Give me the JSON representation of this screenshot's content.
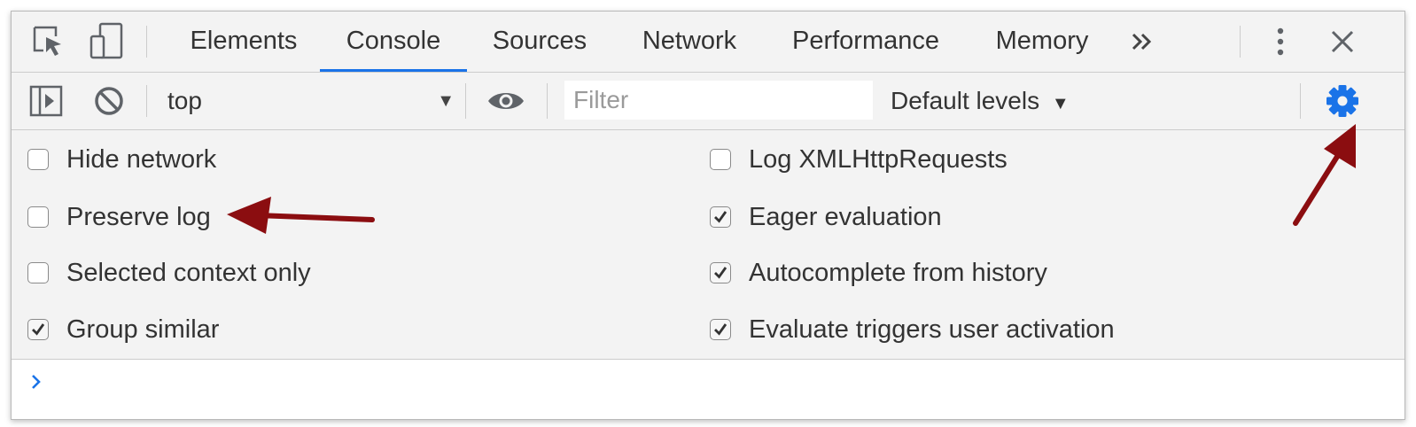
{
  "tabs": [
    {
      "label": "Elements",
      "active": false
    },
    {
      "label": "Console",
      "active": true
    },
    {
      "label": "Sources",
      "active": false
    },
    {
      "label": "Network",
      "active": false
    },
    {
      "label": "Performance",
      "active": false
    },
    {
      "label": "Memory",
      "active": false
    }
  ],
  "tabbar_icons": {
    "inspect": "inspect-element-icon",
    "device": "device-toolbar-icon",
    "more_tabs": "chevron-double-right-icon",
    "menu": "more-vertical-icon",
    "close": "close-icon"
  },
  "toolbar": {
    "sidebar_icon": "show-console-sidebar-icon",
    "clear_icon": "clear-console-icon",
    "context": "top",
    "eye_icon": "live-expression-icon",
    "filter_placeholder": "Filter",
    "filter_value": "",
    "levels_label": "Default levels",
    "settings_icon": "gear-icon"
  },
  "settings": {
    "left": [
      {
        "label": "Hide network",
        "checked": false
      },
      {
        "label": "Preserve log",
        "checked": false
      },
      {
        "label": "Selected context only",
        "checked": false
      },
      {
        "label": "Group similar",
        "checked": true
      }
    ],
    "right": [
      {
        "label": "Log XMLHttpRequests",
        "checked": false
      },
      {
        "label": "Eager evaluation",
        "checked": true
      },
      {
        "label": "Autocomplete from history",
        "checked": true
      },
      {
        "label": "Evaluate triggers user activation",
        "checked": true
      }
    ]
  },
  "console": {
    "prompt_icon": "chevron-right-icon"
  },
  "annotations": [
    {
      "name": "arrow-to-preserve-log",
      "color": "#8b0d10"
    },
    {
      "name": "arrow-to-settings-gear",
      "color": "#8b0d10"
    }
  ],
  "colors": {
    "accent": "#1a73e8",
    "toolbar_bg": "#f3f3f3",
    "annotation": "#8b0d10"
  }
}
